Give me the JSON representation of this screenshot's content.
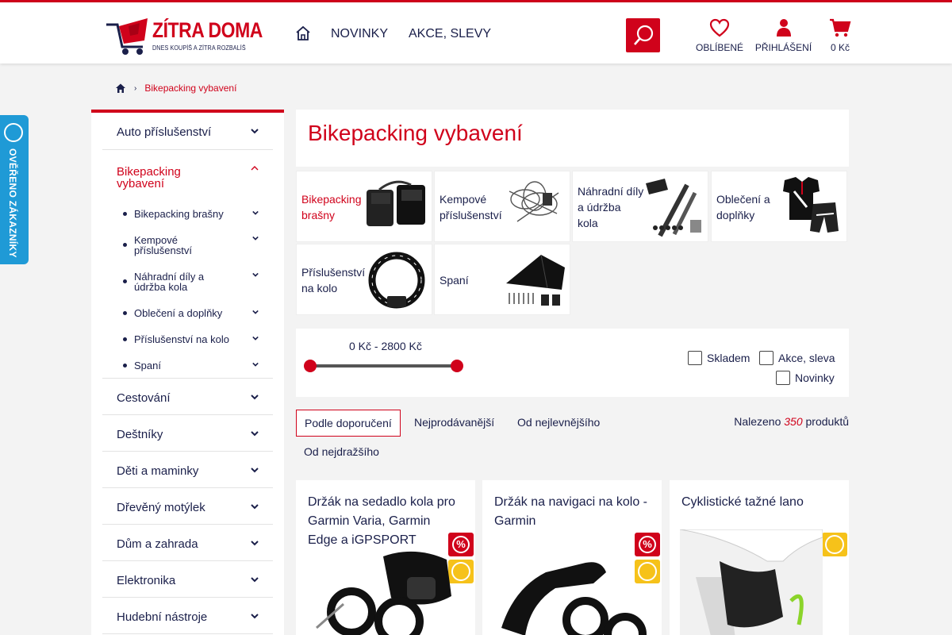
{
  "brand": {
    "name": "ZÍTRA DOMA",
    "tagline": "DNES KOUPÍŠ A ZÍTRA ROZBALÍŠ",
    "accent": "#d0021b",
    "navy": "#1a1f4a"
  },
  "header": {
    "nav": [
      "NOVINKY",
      "AKCE, SLEVY"
    ],
    "favorites": "OBLÍBENÉ",
    "login": "PŘIHLÁŠENÍ",
    "cart": "0 Kč"
  },
  "side_badge": {
    "text": "OVĚŘENO ZÁKAZNÍKY"
  },
  "breadcrumb": {
    "current": "Bikepacking vybavení"
  },
  "sidebar": {
    "categories": [
      {
        "label": "Auto příslušenství"
      },
      {
        "label": "Bikepacking vybavení",
        "active": true
      },
      {
        "label": "Cestování"
      },
      {
        "label": "Deštníky"
      },
      {
        "label": "Děti a maminky"
      },
      {
        "label": "Dřevěný motýlek"
      },
      {
        "label": "Dům a zahrada"
      },
      {
        "label": "Elektronika"
      },
      {
        "label": "Hudební nástroje"
      }
    ],
    "subcategories": [
      {
        "label": "Bikepacking brašny"
      },
      {
        "label": "Kempové příslušenství"
      },
      {
        "label": "Náhradní díly a údržba kola"
      },
      {
        "label": "Oblečení a doplňky"
      },
      {
        "label": "Příslušenství na kolo"
      },
      {
        "label": "Spaní"
      }
    ]
  },
  "page": {
    "title": "Bikepacking vybavení"
  },
  "tiles": [
    {
      "label": "Bikepacking brašny",
      "icon": "bike-bag-image"
    },
    {
      "label": "Kempové příslušenství",
      "icon": "camp-rope-image"
    },
    {
      "label": "Náhradní díly a údržba kola",
      "icon": "bike-tools-image"
    },
    {
      "label": "Oblečení a doplňky",
      "icon": "cycling-jersey-image"
    },
    {
      "label": "Příslušenství na kolo",
      "icon": "bike-lock-image"
    },
    {
      "label": "Spaní",
      "icon": "tent-image"
    }
  ],
  "filters": {
    "price_range": "0 Kč - 2800 Kč",
    "price_min": 0,
    "price_max": 2800,
    "checkboxes": [
      {
        "label": "Skladem",
        "checked": false
      },
      {
        "label": "Akce, sleva",
        "checked": false
      },
      {
        "label": "Novinky",
        "checked": false
      }
    ]
  },
  "sorting": {
    "options": [
      "Podle doporučení",
      "Nejprodávanější",
      "Od nejlevnějšího",
      "Od nejdražšího"
    ],
    "selected": "Podle doporučení"
  },
  "results": {
    "prefix": "Nalezeno",
    "count": "350",
    "suffix": "produktů"
  },
  "products": [
    {
      "title": "Držák na sedadlo kola pro Garmin Varia, Garmin Edge a iGPSPORT",
      "discount": true,
      "verified": true
    },
    {
      "title": "Držák na navigaci na kolo - Garmin",
      "discount": true,
      "verified": true
    },
    {
      "title": "Cyklistické tažné lano",
      "discount": false,
      "verified": true
    }
  ]
}
